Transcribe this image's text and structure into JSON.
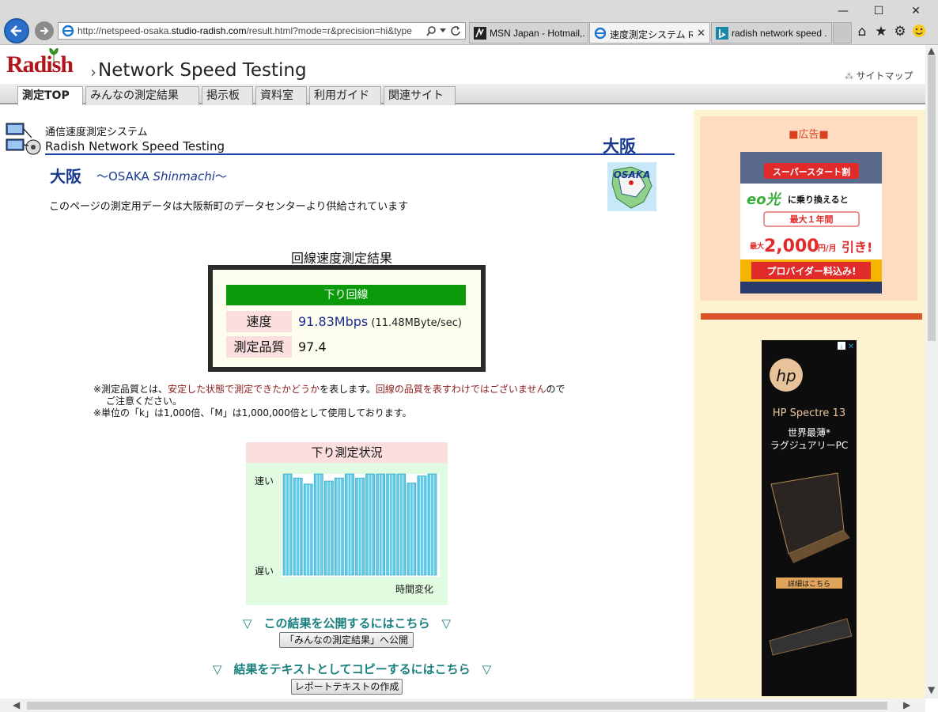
{
  "browser": {
    "url_prefix": "http://netspeed-osaka.",
    "url_domain": "studio-radish.com",
    "url_suffix": "/result.html?mode=r&precision=hi&type",
    "tabs": [
      {
        "label": "MSN Japan - Hotmail,..."
      },
      {
        "label": "速度測定システム Ra..."
      },
      {
        "label": "radish network speed ..."
      }
    ]
  },
  "header": {
    "logo": "Radish",
    "site_title": "Network Speed Testing",
    "sitemap": "サイトマップ",
    "nav": [
      {
        "label": "測定TOP"
      },
      {
        "label": "みんなの測定結果"
      },
      {
        "label": "掲示板"
      },
      {
        "label": "資料室"
      },
      {
        "label": "利用ガイド"
      },
      {
        "label": "関連サイト"
      }
    ]
  },
  "main": {
    "system_label": "通信速度測定システム",
    "system_name": "Radish Network Speed Testing",
    "city_big": "大阪",
    "city_title": "大阪",
    "city_sub_prefix": "～OSAKA ",
    "city_sub_italic": "Shinmachi",
    "city_sub_suffix": "～",
    "map_label": "OSAKA",
    "data_note": "このページの測定用データは大阪新町のデータセンターより供給されています",
    "result_caption": "回線速度測定結果",
    "result_head": "下り回線",
    "speed_label": "速度",
    "speed_value": "91.83Mbps",
    "speed_sub": " (11.48MByte/sec)",
    "quality_label": "測定品質",
    "quality_value": "97.4",
    "note1_a": "※測定品質とは、",
    "note1_b": "安定した状態で測定できたかどうか",
    "note1_c": "を表します。",
    "note1_d": "回線の品質を表すわけではございません",
    "note1_e": "ので",
    "note1_f": "ご注意ください。",
    "note2": "※単位の「k」は1,000倍、「M」は1,000,000倍として使用しております。",
    "status_head": "下り測定状況",
    "cta_publish": "▽　この結果を公開するにはこちら　▽",
    "btn_publish": "「みんなの測定結果」へ公開",
    "cta_copy": "▽　結果をテキストとしてコピーするにはこちら　▽",
    "btn_report": "レポートテキストの作成"
  },
  "chart_data": {
    "type": "bar",
    "title": "下り測定状況",
    "ylabel_top": "速い",
    "ylabel_bottom": "遅い",
    "xlabel": "時間変化",
    "values": [
      100,
      96,
      90,
      100,
      93,
      96,
      100,
      96,
      100,
      100,
      100,
      100,
      91,
      98,
      100
    ],
    "ylim": [
      0,
      100
    ],
    "bar_color": "#62cbe6"
  },
  "sidebar": {
    "ad_label": "■広告■",
    "ad1": {
      "line1": "スーパースタート割",
      "line2_brand": "eo光",
      "line2_rest": "に乗り換えると",
      "line3": "最大１年間",
      "line4_pre": "最大",
      "line4_amount": "2,000",
      "line4_unit": "円/月",
      "line4_post": "引き!",
      "line5": "プロバイダー料込み!"
    },
    "ad2": {
      "brand": "hp",
      "product": "HP Spectre 13",
      "tag1": "世界最薄*",
      "tag2": "ラグジュアリーPC",
      "cta": "詳細はこちら"
    }
  }
}
